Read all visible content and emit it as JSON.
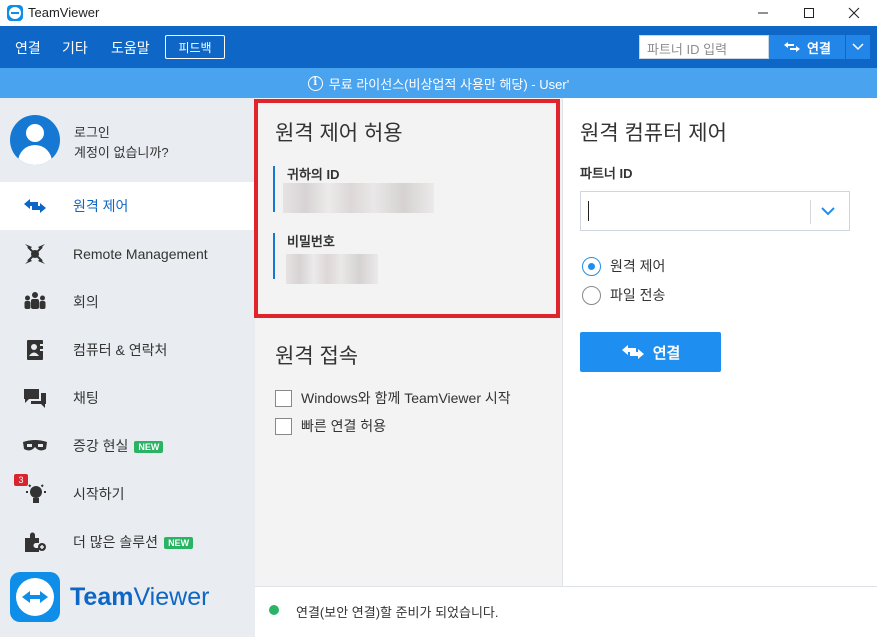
{
  "window": {
    "title": "TeamViewer"
  },
  "menu": {
    "connect": "연결",
    "extra": "기타",
    "help": "도움말",
    "feedback": "피드백"
  },
  "partner_quick": {
    "placeholder": "파트너 ID 입력",
    "connect_label": "연결"
  },
  "banner": {
    "text": "무료 라이선스(비상업적 사용만 해당) - User'"
  },
  "sidebar": {
    "login": "로그인",
    "no_account": "계정이 없습니까?",
    "items": [
      {
        "label": "원격 제어",
        "icon": "arrows-icon",
        "active": true
      },
      {
        "label": "Remote Management",
        "icon": "remote-management-icon"
      },
      {
        "label": "회의",
        "icon": "meeting-icon"
      },
      {
        "label": "컴퓨터 & 연락처",
        "icon": "contacts-icon"
      },
      {
        "label": "채팅",
        "icon": "chat-icon"
      },
      {
        "label": "증강 현실",
        "icon": "ar-glasses-icon",
        "badge": "NEW"
      },
      {
        "label": "시작하기",
        "icon": "lightbulb-icon",
        "notification": "3"
      },
      {
        "label": "더 많은 솔루션",
        "icon": "puzzle-icon",
        "badge": "NEW"
      }
    ],
    "logo_bold": "Team",
    "logo_regular": "Viewer"
  },
  "allow_remote": {
    "title": "원격 제어 허용",
    "id_label": "귀하의 ID",
    "password_label": "비밀번호"
  },
  "unattended": {
    "title": "원격 접속",
    "start_with_windows": "Windows와 함께 TeamViewer 시작",
    "easy_access": "빠른 연결 허용"
  },
  "control_remote": {
    "title": "원격 컴퓨터 제어",
    "partner_id_label": "파트너 ID",
    "partner_id_value": "",
    "mode_remote": "원격 제어",
    "mode_file": "파일 전송",
    "connect_label": "연결"
  },
  "status": {
    "text": "연결(보안 연결)할 준비가 되었습니다.",
    "color": "#28b463"
  },
  "colors": {
    "menu_bar": "#0e67c6",
    "banner": "#4aa3ee",
    "accent": "#1e8ff0",
    "highlight_border": "#e0242c"
  }
}
